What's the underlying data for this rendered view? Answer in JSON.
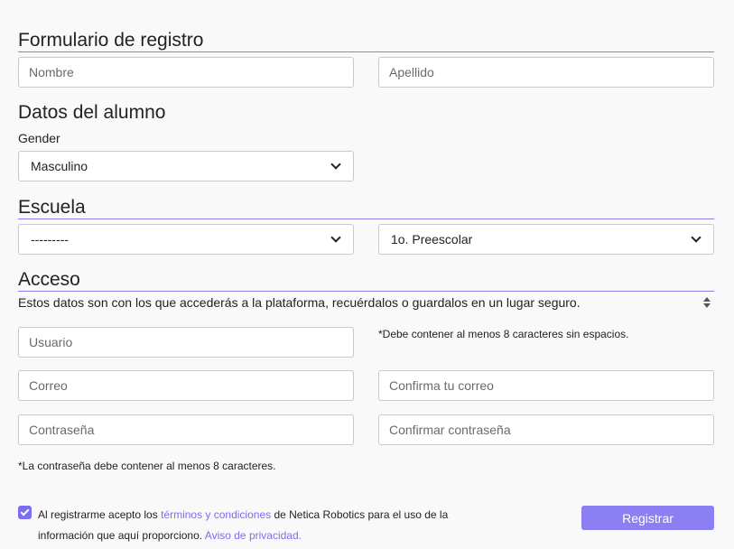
{
  "form": {
    "title": "Formulario de registro",
    "nombre_placeholder": "Nombre",
    "apellido_placeholder": "Apellido"
  },
  "student": {
    "title": "Datos del alumno",
    "gender_label": "Gender",
    "gender_value": "Masculino"
  },
  "school": {
    "title": "Escuela",
    "school_value": "---------",
    "grade_value": "1o. Preescolar"
  },
  "access": {
    "title": "Acceso",
    "help_text": "Estos datos son con los que accederás a la plataforma, recuérdalos o guardalos en un lugar seguro.",
    "usuario_placeholder": "Usuario",
    "usuario_note": "*Debe contener al menos 8 caracteres sin espacios.",
    "correo_placeholder": "Correo",
    "confirma_correo_placeholder": "Confirma tu correo",
    "password_placeholder": "Contraseña",
    "confirm_password_placeholder": "Confirmar contraseña",
    "password_note": "*La contraseña debe contener al menos 8 caracteres."
  },
  "terms": {
    "checked": true,
    "text_before": "Al registrarme acepto los ",
    "terms_link": "términos y condiciones",
    "text_middle": " de Netica Robotics para el uso de la información que aquí proporciono. ",
    "privacy_link": "Aviso de privacidad."
  },
  "actions": {
    "register_label": "Registrar"
  },
  "colors": {
    "accent": "#8b7ff3",
    "link": "#7b6ef0",
    "background": "#f9f9f9"
  }
}
